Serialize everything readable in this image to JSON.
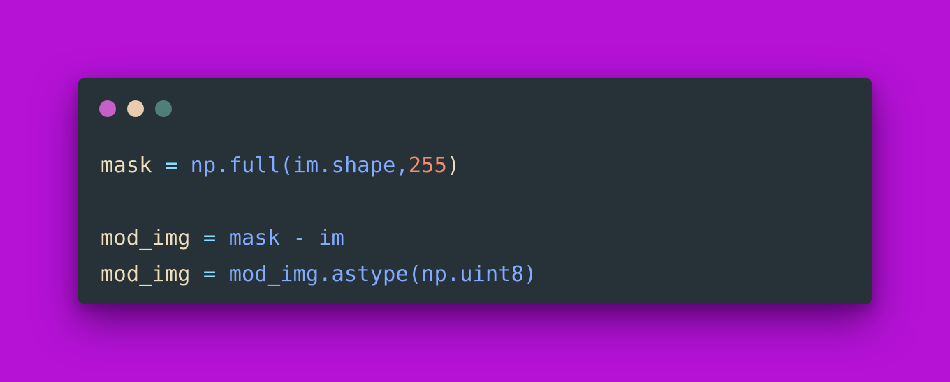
{
  "colors": {
    "background": "#b512d6",
    "window_bg": "#263238",
    "dot_1": "#c75fc9",
    "dot_2": "#e9cbae",
    "dot_3": "#4f7f78",
    "var": "#eeddbb",
    "operator": "#89ddff",
    "function": "#82aaff",
    "number": "#f78c6c"
  },
  "window_controls": [
    {
      "name": "close-dot"
    },
    {
      "name": "minimize-dot"
    },
    {
      "name": "maximize-dot"
    }
  ],
  "code": {
    "line1": {
      "t1": "mask",
      "t2": " = ",
      "t3": "np.full(im.shape,",
      "t4": "255",
      "t5": ")"
    },
    "line2": "",
    "line3": {
      "t1": "mod_img",
      "t2": " = ",
      "t3": "mask - im"
    },
    "line4": {
      "t1": "mod_img",
      "t2": " = ",
      "t3": "mod_img.astype(np.uint8)"
    }
  }
}
